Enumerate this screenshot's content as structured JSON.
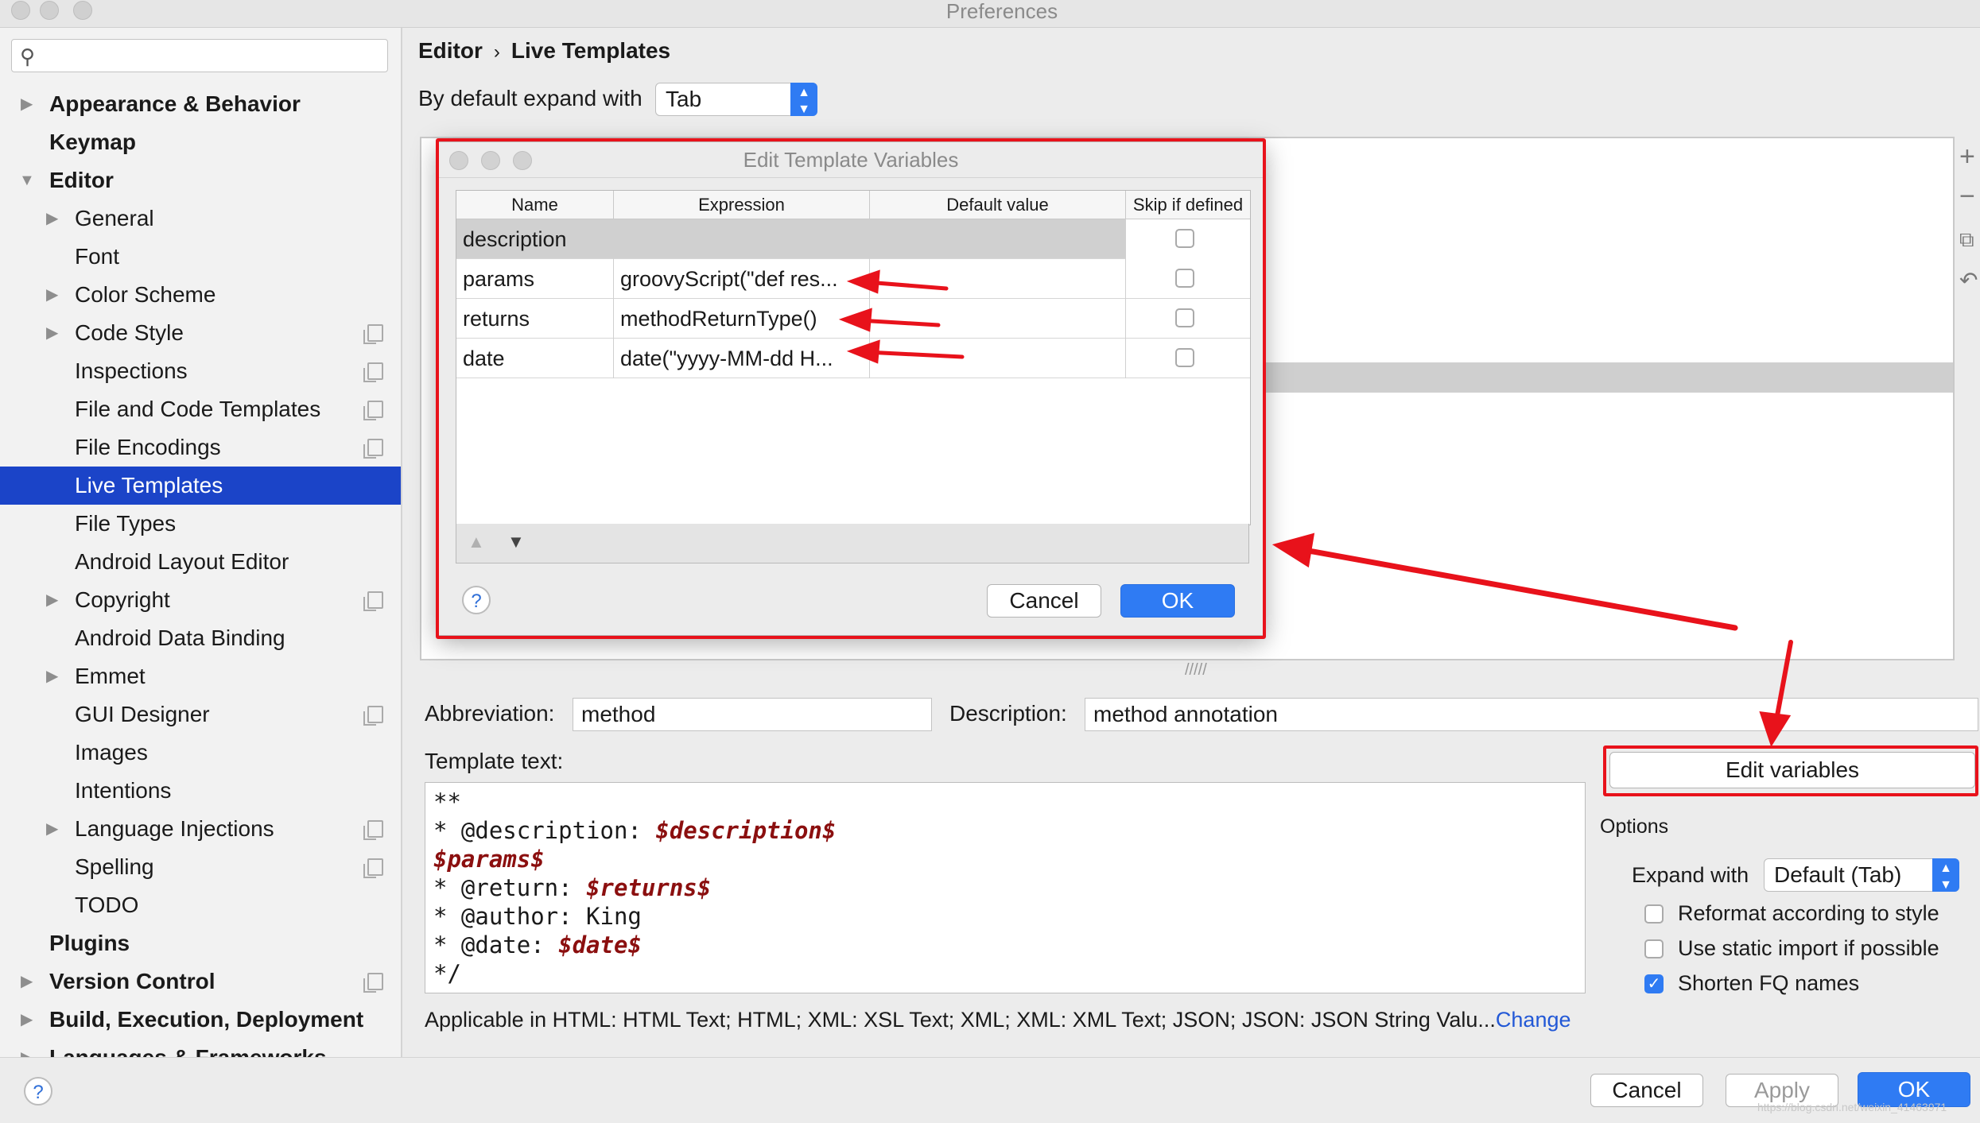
{
  "window": {
    "title": "Preferences"
  },
  "sidebar": {
    "search_placeholder": "",
    "items": [
      {
        "label": "Appearance & Behavior"
      },
      {
        "label": "Keymap"
      },
      {
        "label": "Editor"
      },
      {
        "label": "General"
      },
      {
        "label": "Font"
      },
      {
        "label": "Color Scheme"
      },
      {
        "label": "Code Style"
      },
      {
        "label": "Inspections"
      },
      {
        "label": "File and Code Templates"
      },
      {
        "label": "File Encodings"
      },
      {
        "label": "Live Templates"
      },
      {
        "label": "File Types"
      },
      {
        "label": "Android Layout Editor"
      },
      {
        "label": "Copyright"
      },
      {
        "label": "Android Data Binding"
      },
      {
        "label": "Emmet"
      },
      {
        "label": "GUI Designer"
      },
      {
        "label": "Images"
      },
      {
        "label": "Intentions"
      },
      {
        "label": "Language Injections"
      },
      {
        "label": "Spelling"
      },
      {
        "label": "TODO"
      },
      {
        "label": "Plugins"
      },
      {
        "label": "Version Control"
      },
      {
        "label": "Build, Execution, Deployment"
      },
      {
        "label": "Languages & Frameworks"
      }
    ]
  },
  "breadcrumb": {
    "parent": "Editor",
    "separator": "›",
    "current": "Live Templates"
  },
  "expand_default": {
    "label": "By default expand with",
    "value": "Tab"
  },
  "template_list": {
    "add": "+",
    "remove": "−"
  },
  "abbreviation": {
    "label": "Abbreviation:",
    "value": "method"
  },
  "description": {
    "label": "Description:",
    "value": "method annotation"
  },
  "template_text": {
    "label": "Template text:",
    "lines": [
      {
        "text": "**",
        "var": ""
      },
      {
        "text": " * @description: ",
        "var": "$description$"
      },
      {
        "text": " ",
        "var": "$params$"
      },
      {
        "text": " * @return: ",
        "var": "$returns$"
      },
      {
        "text": " * @author: King",
        "var": ""
      },
      {
        "text": " * @date: ",
        "var": "$date$"
      },
      {
        "text": " */",
        "var": ""
      }
    ]
  },
  "edit_variables_button": "Edit variables",
  "options": {
    "title": "Options",
    "expand_with_label": "Expand with",
    "expand_with_value": "Default (Tab)",
    "reformat": "Reformat according to style",
    "static_import": "Use static import if possible",
    "shorten_fq": "Shorten FQ names",
    "reformat_checked": false,
    "static_import_checked": false,
    "shorten_fq_checked": true
  },
  "applicable": {
    "text": "Applicable in HTML: HTML Text; HTML; XML: XSL Text; XML; XML: XML Text; JSON; JSON: JSON String Valu...",
    "link": "Change"
  },
  "footer": {
    "help": "?",
    "cancel": "Cancel",
    "apply": "Apply",
    "ok": "OK",
    "watermark": "https://blog.csdn.net/weixin_41463971"
  },
  "dialog": {
    "title": "Edit Template Variables",
    "columns": [
      "Name",
      "Expression",
      "Default value",
      "Skip if defined"
    ],
    "rows": [
      {
        "name": "description",
        "expression": "",
        "default": "",
        "skip": false
      },
      {
        "name": "params",
        "expression": "groovyScript(\"def res...",
        "default": "",
        "skip": false
      },
      {
        "name": "returns",
        "expression": "methodReturnType()",
        "default": "",
        "skip": false
      },
      {
        "name": "date",
        "expression": "date(\"yyyy-MM-dd H...",
        "default": "",
        "skip": false
      }
    ],
    "help": "?",
    "cancel": "Cancel",
    "ok": "OK"
  },
  "colors": {
    "accent": "#2f7bf3",
    "selection": "#1b44c8",
    "annotation": "#e8121b",
    "template_variable": "#8b0f0f"
  }
}
